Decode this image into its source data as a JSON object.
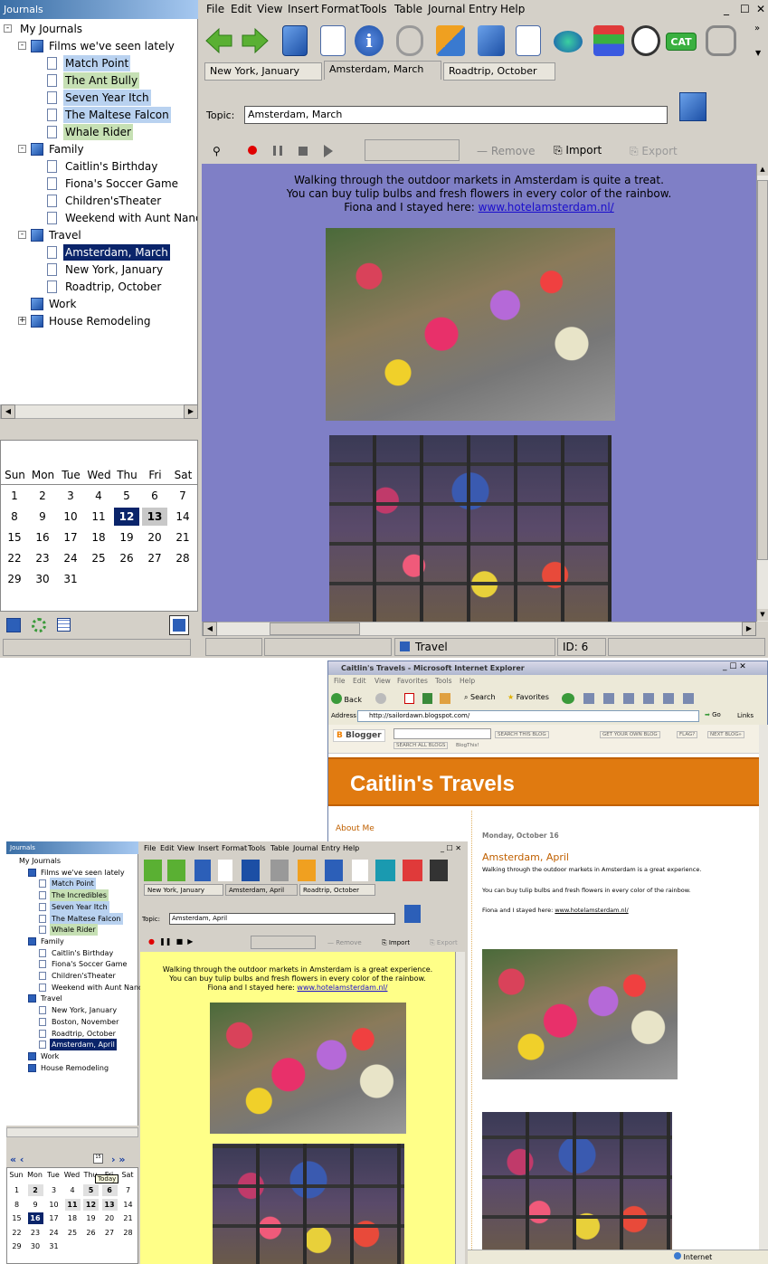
{
  "app": {
    "panel_title": "Journals",
    "menu": [
      "File",
      "Edit",
      "View",
      "Insert",
      "Format",
      "Tools",
      "Table",
      "Journal",
      "Entry",
      "Help"
    ],
    "tree": [
      {
        "label": "My Journals",
        "level": 0,
        "type": "root",
        "box": "-"
      },
      {
        "label": "Films we've seen lately",
        "level": 1,
        "type": "folder",
        "box": "-"
      },
      {
        "label": "Match Point",
        "level": 2,
        "type": "page",
        "hl": "b"
      },
      {
        "label": "The Ant Bully",
        "level": 2,
        "type": "page",
        "hl": "g"
      },
      {
        "label": "Seven Year Itch",
        "level": 2,
        "type": "page",
        "hl": "b"
      },
      {
        "label": "The Maltese Falcon",
        "level": 2,
        "type": "page",
        "hl": "b"
      },
      {
        "label": "Whale Rider",
        "level": 2,
        "type": "page",
        "hl": "g"
      },
      {
        "label": "Family",
        "level": 1,
        "type": "folder",
        "box": "-"
      },
      {
        "label": "Caitlin's Birthday",
        "level": 2,
        "type": "page"
      },
      {
        "label": "Fiona's Soccer Game",
        "level": 2,
        "type": "page"
      },
      {
        "label": "Children'sTheater",
        "level": 2,
        "type": "page"
      },
      {
        "label": "Weekend with Aunt Nancy",
        "level": 2,
        "type": "page"
      },
      {
        "label": "Travel",
        "level": 1,
        "type": "folder",
        "box": "-"
      },
      {
        "label": "Amsterdam, March",
        "level": 2,
        "type": "page",
        "hl": "s"
      },
      {
        "label": "New York, January",
        "level": 2,
        "type": "page"
      },
      {
        "label": "Roadtrip, October",
        "level": 2,
        "type": "page"
      },
      {
        "label": "Work",
        "level": 1,
        "type": "folder"
      },
      {
        "label": "House Remodeling",
        "level": 1,
        "type": "folder",
        "box": "+"
      }
    ],
    "calendar": {
      "headers": [
        "Sun",
        "Mon",
        "Tue",
        "Wed",
        "Thu",
        "Fri",
        "Sat"
      ],
      "offset": 0,
      "days": 31,
      "selected": 12,
      "highlighted": [
        13
      ],
      "nav_first": "«",
      "nav_prev": "‹",
      "nav_next": "›",
      "nav_last": "»",
      "today_icon": "15"
    },
    "tabs": [
      "New York, January",
      "Amsterdam, March",
      "Roadtrip, October"
    ],
    "active_tab": 1,
    "topic_label": "Topic:",
    "topic_value": "Amsterdam, March",
    "media": {
      "remove": "Remove",
      "import": "Import",
      "export": "Export"
    },
    "content": {
      "line1": "Walking through the outdoor markets in Amsterdam is quite a treat.",
      "line2": "You can buy tulip bulbs and fresh flowers in every color of the rainbow.",
      "line3_prefix": "Fiona and I stayed here: ",
      "link": "www.hotelamsterdam.nl/"
    },
    "status": {
      "journal": "Travel",
      "id": "ID: 6"
    },
    "colors": {
      "content_bg": "#7f7fc6",
      "selection": "#0a246a"
    },
    "toolbar_cat": "CAT"
  },
  "app2": {
    "panel_title": "Journals",
    "menu": [
      "File",
      "Edit",
      "View",
      "Insert",
      "Format",
      "Tools",
      "Table",
      "Journal",
      "Entry",
      "Help"
    ],
    "tree": [
      {
        "label": "My Journals",
        "level": 0
      },
      {
        "label": "Films we've seen lately",
        "level": 1,
        "type": "folder"
      },
      {
        "label": "Match Point",
        "level": 2,
        "hl": "b"
      },
      {
        "label": "The Incredibles",
        "level": 2,
        "hl": "g"
      },
      {
        "label": "Seven Year Itch",
        "level": 2,
        "hl": "b"
      },
      {
        "label": "The Maltese Falcon",
        "level": 2,
        "hl": "b"
      },
      {
        "label": "Whale Rider",
        "level": 2,
        "hl": "g"
      },
      {
        "label": "Family",
        "level": 1,
        "type": "folder"
      },
      {
        "label": "Caitlin's Birthday",
        "level": 2
      },
      {
        "label": "Fiona's Soccer Game",
        "level": 2
      },
      {
        "label": "Children'sTheater",
        "level": 2
      },
      {
        "label": "Weekend with Aunt Nancy",
        "level": 2
      },
      {
        "label": "Travel",
        "level": 1,
        "type": "folder"
      },
      {
        "label": "New York, January",
        "level": 2
      },
      {
        "label": "Boston, November",
        "level": 2
      },
      {
        "label": "Roadtrip, October",
        "level": 2
      },
      {
        "label": "Amsterdam, April",
        "level": 2,
        "hl": "s"
      },
      {
        "label": "Work",
        "level": 1,
        "type": "folder"
      },
      {
        "label": "House Remodeling",
        "level": 1,
        "type": "folder"
      }
    ],
    "tabs": [
      "New York, January",
      "Amsterdam, April",
      "Roadtrip, October"
    ],
    "topic_label": "Topic:",
    "topic_value": "Amsterdam, April",
    "media": {
      "remove": "Remove",
      "import": "Import",
      "export": "Export"
    },
    "content": {
      "line1": "Walking through the outdoor markets in Amsterdam is a great experience.",
      "line2": "You can buy tulip bulbs and fresh flowers in every color of the rainbow.",
      "line3_prefix": "Fiona and I stayed here: ",
      "link": "www.hotelamsterdam.nl/"
    },
    "tooltip": "Today",
    "calendar": {
      "headers": [
        "Sun",
        "Mon",
        "Tue",
        "Wed",
        "Thu",
        "Fri",
        "Sat"
      ],
      "offset": 0,
      "days": 31,
      "selected": 16,
      "bold": [
        2,
        5,
        6,
        11,
        12,
        13
      ],
      "today_icon": "15"
    },
    "colors": {
      "content_bg": "#ffff88"
    }
  },
  "ie": {
    "title": "Caitlin's Travels - Microsoft Internet Explorer",
    "menu": [
      "File",
      "Edit",
      "View",
      "Favorites",
      "Tools",
      "Help"
    ],
    "back": "Back",
    "search": "Search",
    "favorites": "Favorites",
    "address_label": "Address",
    "address": "http://sailordawn.blogspot.com/",
    "go": "Go",
    "links": "Links",
    "blogger": "Blogger",
    "search_blog": "SEARCH THIS BLOG",
    "search_all": "SEARCH ALL BLOGS",
    "blogthis": "BlogThis!",
    "get_blog": "GET YOUR OWN BLOG",
    "flag": "FLAG?",
    "next_blog": "NEXT BLOG»",
    "blog_title": "Caitlin's Travels",
    "about": "About Me",
    "date": "Monday, October 16",
    "post_title": "Amsterdam, April",
    "p1": "Walking through the outdoor markets in Amsterdam is a great experience.",
    "p2": "You can buy tulip bulbs and fresh flowers in every color of the rainbow.",
    "p3_prefix": "Fiona and I stayed here: ",
    "p3_link": "www.hotelamsterdam.nl/",
    "status_zone": "Internet",
    "colors": {
      "header_bg": "#e07a10",
      "post_title": "#c06000"
    }
  }
}
